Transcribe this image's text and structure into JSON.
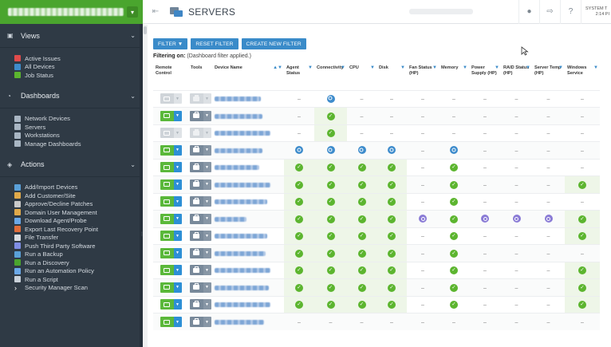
{
  "sidebar": {
    "views_section": {
      "label": "Views",
      "items": [
        {
          "label": "Active Issues",
          "icon": "alert-icon",
          "color": "#e04b4b"
        },
        {
          "label": "All Devices",
          "icon": "monitor-icon",
          "color": "#3e8ccc"
        },
        {
          "label": "Job Status",
          "icon": "check-icon",
          "color": "#5cb52f"
        }
      ]
    },
    "dashboards_section": {
      "label": "Dashboards",
      "items": [
        {
          "label": "Network Devices",
          "icon": "monitor-icon",
          "color": "#a9b6c3"
        },
        {
          "label": "Servers",
          "icon": "monitor-icon",
          "color": "#a9b6c3"
        },
        {
          "label": "Workstations",
          "icon": "monitor-icon",
          "color": "#a9b6c3"
        },
        {
          "label": "Manage Dashboards",
          "icon": "monitor-icon",
          "color": "#a9b6c3"
        }
      ]
    },
    "actions_section": {
      "label": "Actions",
      "items": [
        {
          "label": "Add/Import Devices",
          "icon": "device-add-icon",
          "color": "#5aa0d8"
        },
        {
          "label": "Add Customer/Site",
          "icon": "customer-icon",
          "color": "#e0a94a"
        },
        {
          "label": "Approve/Decline Patches",
          "icon": "patch-icon",
          "color": "#c9c9c9"
        },
        {
          "label": "Domain User Management",
          "icon": "users-icon",
          "color": "#e0a94a"
        },
        {
          "label": "Download Agent/Probe",
          "icon": "download-icon",
          "color": "#6aa8e8"
        },
        {
          "label": "Export Last Recovery Point",
          "icon": "export-icon",
          "color": "#e06d3a"
        },
        {
          "label": "File Transfer",
          "icon": "file-icon",
          "color": "#d9dee3"
        },
        {
          "label": "Push Third Party Software",
          "icon": "push-icon",
          "color": "#7f8ee6"
        },
        {
          "label": "Run a Backup",
          "icon": "backup-icon",
          "color": "#5aa0d8"
        },
        {
          "label": "Run a Discovery",
          "icon": "discovery-icon",
          "color": "#4aa52e"
        },
        {
          "label": "Run an Automation Policy",
          "icon": "automation-icon",
          "color": "#6aa8e8"
        },
        {
          "label": "Run a Script",
          "icon": "script-icon",
          "color": "#c9d1d9"
        },
        {
          "label": "Security Manager Scan",
          "icon": "chevron-right-icon",
          "color": "#ffffff"
        }
      ]
    }
  },
  "header": {
    "title": "SERVERS",
    "system_label": "SYSTEM T",
    "time": "2:14 PI"
  },
  "toolbar": {
    "filter_label": "FILTER ▼",
    "reset_label": "RESET FILTER",
    "create_label": "CREATE NEW FILTER"
  },
  "filter_info": {
    "label": "Filtering on:",
    "value": "(Dashboard filter applied.)"
  },
  "table": {
    "columns": [
      "Remote Control",
      "Tools",
      "Device Name",
      "Agent Status",
      "Connectivity",
      "CPU",
      "Disk",
      "Fan Status (HP)",
      "Memory",
      "Power Supply (HP)",
      "RAID Status (HP)",
      "Server Temp (HP)",
      "Windows Service"
    ],
    "rows": [
      {
        "enabled": false,
        "name_w": 58,
        "status": [
          "-",
          "na",
          "-",
          "-",
          "-",
          "-",
          "-",
          "-",
          "-",
          "-"
        ]
      },
      {
        "enabled": true,
        "name_w": 60,
        "status": [
          "-",
          "ok",
          "-",
          "-",
          "-",
          "-",
          "-",
          "-",
          "-",
          "-"
        ]
      },
      {
        "enabled": false,
        "name_w": 70,
        "status": [
          "-",
          "ok",
          "-",
          "-",
          "-",
          "-",
          "-",
          "-",
          "-",
          "-"
        ]
      },
      {
        "enabled": true,
        "name_w": 60,
        "status": [
          "na",
          "na",
          "na",
          "na",
          "-",
          "na",
          "-",
          "-",
          "-",
          "-"
        ]
      },
      {
        "enabled": true,
        "name_w": 56,
        "status": [
          "ok",
          "ok",
          "ok",
          "ok",
          "-",
          "ok",
          "-",
          "-",
          "-",
          "-"
        ]
      },
      {
        "enabled": true,
        "name_w": 70,
        "status": [
          "ok",
          "ok",
          "ok",
          "ok",
          "-",
          "ok",
          "-",
          "-",
          "-",
          "ok"
        ]
      },
      {
        "enabled": true,
        "name_w": 66,
        "status": [
          "ok",
          "ok",
          "ok",
          "ok",
          "-",
          "ok",
          "-",
          "-",
          "-",
          "-"
        ]
      },
      {
        "enabled": true,
        "name_w": 40,
        "status": [
          "ok",
          "ok",
          "ok",
          "ok",
          "ext",
          "ok",
          "ext",
          "ext",
          "ext",
          "ok"
        ]
      },
      {
        "enabled": true,
        "name_w": 66,
        "status": [
          "ok",
          "ok",
          "ok",
          "ok",
          "-",
          "ok",
          "-",
          "-",
          "-",
          "ok"
        ]
      },
      {
        "enabled": true,
        "name_w": 64,
        "status": [
          "ok",
          "ok",
          "ok",
          "ok",
          "-",
          "ok",
          "-",
          "-",
          "-",
          "-"
        ]
      },
      {
        "enabled": true,
        "name_w": 70,
        "status": [
          "ok",
          "ok",
          "ok",
          "ok",
          "-",
          "ok",
          "-",
          "-",
          "-",
          "ok"
        ]
      },
      {
        "enabled": true,
        "name_w": 68,
        "status": [
          "ok",
          "ok",
          "ok",
          "ok",
          "-",
          "ok",
          "-",
          "-",
          "-",
          "ok"
        ]
      },
      {
        "enabled": true,
        "name_w": 70,
        "status": [
          "ok",
          "ok",
          "ok",
          "ok",
          "-",
          "ok",
          "-",
          "-",
          "-",
          "ok"
        ]
      },
      {
        "enabled": true,
        "name_w": 62,
        "status": [
          "-",
          "-",
          "-",
          "-",
          "-",
          "-",
          "-",
          "-",
          "-",
          "-"
        ]
      }
    ]
  },
  "colors": {
    "accent": "#3a8bc9",
    "ok": "#5cb52f",
    "na": "#3e8ccc",
    "ext": "#8a7bd6",
    "sidebar": "#2f3a45",
    "brand_green": "#4aa52e"
  }
}
